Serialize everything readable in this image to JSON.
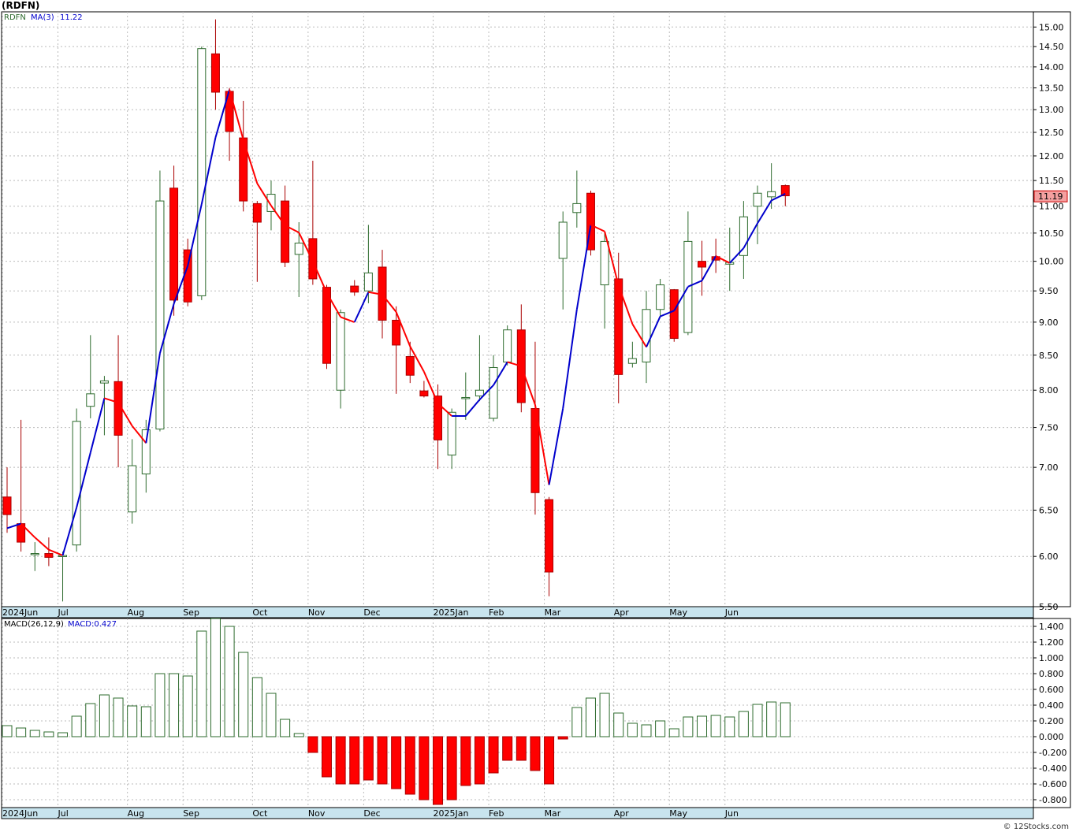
{
  "title": "(RDFN)",
  "credit": "© 12Stocks.com",
  "colors": {
    "up_fill": "#ffffff",
    "up_stroke": "#2e6b2e",
    "down_fill": "#ff0000",
    "down_stroke": "#aa0000",
    "ma_up": "#0000cc",
    "ma_down": "#ff0000",
    "axis_band": "#c8e4ee",
    "grid": "#bbbbbb"
  },
  "chart_data": [
    {
      "type": "candlestick",
      "legend": {
        "symbol": "RDFN",
        "ma_label": "MA(3)",
        "ma_value": "11.22"
      },
      "last_price_label": "11.19",
      "ylim": [
        5.5,
        15.4
      ],
      "log_scale": true,
      "y_ticks": [
        "15.00",
        "14.50",
        "14.00",
        "13.50",
        "13.00",
        "12.50",
        "12.00",
        "11.50",
        "11.00",
        "10.50",
        "10.00",
        "9.50",
        "9.00",
        "8.50",
        "8.00",
        "7.50",
        "7.00",
        "6.50",
        "6.00",
        "5.50"
      ],
      "x_labels": [
        {
          "label": "2024Jun",
          "week": 0
        },
        {
          "label": "Jul",
          "week": 4
        },
        {
          "label": "Aug",
          "week": 9
        },
        {
          "label": "Sep",
          "week": 13
        },
        {
          "label": "Oct",
          "week": 18
        },
        {
          "label": "Nov",
          "week": 22
        },
        {
          "label": "Dec",
          "week": 26
        },
        {
          "label": "2025Jan",
          "week": 31
        },
        {
          "label": "Feb",
          "week": 35
        },
        {
          "label": "Mar",
          "week": 39
        },
        {
          "label": "Apr",
          "week": 44
        },
        {
          "label": "May",
          "week": 48
        },
        {
          "label": "Jun",
          "week": 52
        }
      ],
      "candles": [
        {
          "o": 6.65,
          "h": 7.0,
          "l": 6.25,
          "c": 6.45
        },
        {
          "o": 6.35,
          "h": 7.6,
          "l": 6.05,
          "c": 6.15
        },
        {
          "o": 6.03,
          "h": 6.15,
          "l": 5.85,
          "c": 6.03
        },
        {
          "o": 6.03,
          "h": 6.2,
          "l": 5.9,
          "c": 5.99
        },
        {
          "o": 6.0,
          "h": 6.05,
          "l": 5.55,
          "c": 6.01
        },
        {
          "o": 6.12,
          "h": 7.75,
          "l": 6.05,
          "c": 7.58
        },
        {
          "o": 7.78,
          "h": 8.8,
          "l": 7.62,
          "c": 7.95
        },
        {
          "o": 8.1,
          "h": 8.2,
          "l": 7.4,
          "c": 8.13
        },
        {
          "o": 8.12,
          "h": 8.8,
          "l": 7.0,
          "c": 7.4
        },
        {
          "o": 6.48,
          "h": 7.35,
          "l": 6.35,
          "c": 7.02
        },
        {
          "o": 6.92,
          "h": 7.6,
          "l": 6.7,
          "c": 7.47
        },
        {
          "o": 7.48,
          "h": 11.7,
          "l": 7.45,
          "c": 11.1
        },
        {
          "o": 11.35,
          "h": 11.8,
          "l": 9.1,
          "c": 9.35
        },
        {
          "o": 10.2,
          "h": 10.4,
          "l": 9.25,
          "c": 9.32
        },
        {
          "o": 9.42,
          "h": 14.5,
          "l": 9.35,
          "c": 14.45
        },
        {
          "o": 14.32,
          "h": 15.2,
          "l": 13.0,
          "c": 13.4
        },
        {
          "o": 13.42,
          "h": 13.5,
          "l": 11.9,
          "c": 12.52
        },
        {
          "o": 12.38,
          "h": 13.2,
          "l": 10.9,
          "c": 11.1
        },
        {
          "o": 11.05,
          "h": 11.1,
          "l": 9.65,
          "c": 10.7
        },
        {
          "o": 10.9,
          "h": 11.5,
          "l": 10.55,
          "c": 11.23
        },
        {
          "o": 11.1,
          "h": 11.4,
          "l": 9.9,
          "c": 9.98
        },
        {
          "o": 10.12,
          "h": 10.7,
          "l": 9.4,
          "c": 10.32
        },
        {
          "o": 10.4,
          "h": 11.9,
          "l": 9.6,
          "c": 9.7
        },
        {
          "o": 9.56,
          "h": 9.6,
          "l": 8.3,
          "c": 8.38
        },
        {
          "o": 8.0,
          "h": 9.2,
          "l": 7.75,
          "c": 9.15
        },
        {
          "o": 9.58,
          "h": 9.68,
          "l": 9.42,
          "c": 9.48
        },
        {
          "o": 9.5,
          "h": 10.65,
          "l": 9.3,
          "c": 9.8
        },
        {
          "o": 9.9,
          "h": 10.2,
          "l": 8.75,
          "c": 9.03
        },
        {
          "o": 9.03,
          "h": 9.25,
          "l": 7.95,
          "c": 8.65
        },
        {
          "o": 8.48,
          "h": 8.7,
          "l": 8.1,
          "c": 8.21
        },
        {
          "o": 7.99,
          "h": 8.13,
          "l": 7.9,
          "c": 7.92
        },
        {
          "o": 7.92,
          "h": 8.08,
          "l": 6.98,
          "c": 7.34
        },
        {
          "o": 7.15,
          "h": 7.75,
          "l": 6.98,
          "c": 7.7
        },
        {
          "o": 7.9,
          "h": 8.25,
          "l": 7.6,
          "c": 7.9
        },
        {
          "o": 7.92,
          "h": 8.8,
          "l": 7.85,
          "c": 8.0
        },
        {
          "o": 7.62,
          "h": 8.5,
          "l": 7.58,
          "c": 8.32
        },
        {
          "o": 8.4,
          "h": 8.95,
          "l": 8.35,
          "c": 8.88
        },
        {
          "o": 8.88,
          "h": 9.28,
          "l": 7.7,
          "c": 7.83
        },
        {
          "o": 7.75,
          "h": 8.7,
          "l": 6.45,
          "c": 6.7
        },
        {
          "o": 6.62,
          "h": 6.65,
          "l": 5.6,
          "c": 5.84
        },
        {
          "o": 10.05,
          "h": 10.9,
          "l": 9.2,
          "c": 10.7
        },
        {
          "o": 10.88,
          "h": 11.7,
          "l": 10.6,
          "c": 11.05
        },
        {
          "o": 11.25,
          "h": 11.3,
          "l": 10.1,
          "c": 10.2
        },
        {
          "o": 9.6,
          "h": 10.52,
          "l": 8.9,
          "c": 10.35
        },
        {
          "o": 9.7,
          "h": 10.15,
          "l": 7.82,
          "c": 8.22
        },
        {
          "o": 8.38,
          "h": 8.7,
          "l": 8.32,
          "c": 8.45
        },
        {
          "o": 8.4,
          "h": 9.5,
          "l": 8.1,
          "c": 9.2
        },
        {
          "o": 9.2,
          "h": 9.7,
          "l": 9.08,
          "c": 9.6
        },
        {
          "o": 9.52,
          "h": 9.53,
          "l": 8.7,
          "c": 8.75
        },
        {
          "o": 8.84,
          "h": 10.9,
          "l": 8.8,
          "c": 10.35
        },
        {
          "o": 10.0,
          "h": 10.36,
          "l": 9.42,
          "c": 9.9
        },
        {
          "o": 10.08,
          "h": 10.4,
          "l": 9.8,
          "c": 10.02
        },
        {
          "o": 9.95,
          "h": 10.6,
          "l": 9.5,
          "c": 9.98
        },
        {
          "o": 10.1,
          "h": 11.1,
          "l": 9.7,
          "c": 10.8
        },
        {
          "o": 11.0,
          "h": 11.4,
          "l": 10.3,
          "c": 11.25
        },
        {
          "o": 11.18,
          "h": 11.85,
          "l": 10.95,
          "c": 11.28
        },
        {
          "o": 11.4,
          "h": 11.42,
          "l": 11.0,
          "c": 11.2
        }
      ],
      "ma3": [
        6.3,
        6.35,
        6.2,
        6.07,
        6.01,
        6.53,
        7.18,
        7.89,
        7.83,
        7.52,
        7.3,
        8.53,
        9.29,
        9.92,
        11.04,
        12.39,
        13.46,
        12.34,
        11.44,
        11.01,
        10.64,
        10.51,
        10.0,
        9.47,
        9.08,
        9.0,
        9.48,
        9.44,
        9.16,
        8.63,
        8.26,
        7.82,
        7.65,
        7.65,
        7.87,
        8.07,
        8.4,
        8.34,
        7.8,
        6.79,
        7.75,
        9.2,
        10.65,
        10.53,
        9.59,
        8.97,
        8.62,
        9.09,
        9.18,
        9.57,
        9.67,
        10.09,
        9.97,
        10.23,
        10.68,
        11.11,
        11.24
      ]
    },
    {
      "type": "bar",
      "legend": {
        "label": "MACD(26,12,9)",
        "value_label": "MACD:0.427"
      },
      "ylim": [
        -0.9,
        1.5
      ],
      "y_ticks": [
        "1.400",
        "1.200",
        "1.000",
        "0.800",
        "0.600",
        "0.400",
        "0.200",
        "0.000",
        "-0.200",
        "-0.400",
        "-0.600",
        "-0.800"
      ],
      "x_labels": [
        {
          "label": "2024Jun",
          "week": 0
        },
        {
          "label": "Jul",
          "week": 4
        },
        {
          "label": "Aug",
          "week": 9
        },
        {
          "label": "Sep",
          "week": 13
        },
        {
          "label": "Oct",
          "week": 18
        },
        {
          "label": "Nov",
          "week": 22
        },
        {
          "label": "Dec",
          "week": 26
        },
        {
          "label": "2025Jan",
          "week": 31
        },
        {
          "label": "Feb",
          "week": 35
        },
        {
          "label": "Mar",
          "week": 39
        },
        {
          "label": "Apr",
          "week": 44
        },
        {
          "label": "May",
          "week": 48
        },
        {
          "label": "Jun",
          "week": 52
        }
      ],
      "values": [
        0.14,
        0.11,
        0.08,
        0.06,
        0.05,
        0.26,
        0.42,
        0.53,
        0.49,
        0.39,
        0.38,
        0.8,
        0.8,
        0.77,
        1.34,
        1.5,
        1.4,
        1.07,
        0.75,
        0.55,
        0.22,
        0.04,
        -0.2,
        -0.51,
        -0.6,
        -0.6,
        -0.55,
        -0.6,
        -0.66,
        -0.73,
        -0.8,
        -0.86,
        -0.8,
        -0.62,
        -0.6,
        -0.46,
        -0.3,
        -0.3,
        -0.43,
        -0.6,
        -0.03,
        0.37,
        0.49,
        0.55,
        0.3,
        0.17,
        0.15,
        0.2,
        0.1,
        0.25,
        0.26,
        0.27,
        0.25,
        0.32,
        0.41,
        0.44,
        0.43
      ]
    }
  ]
}
